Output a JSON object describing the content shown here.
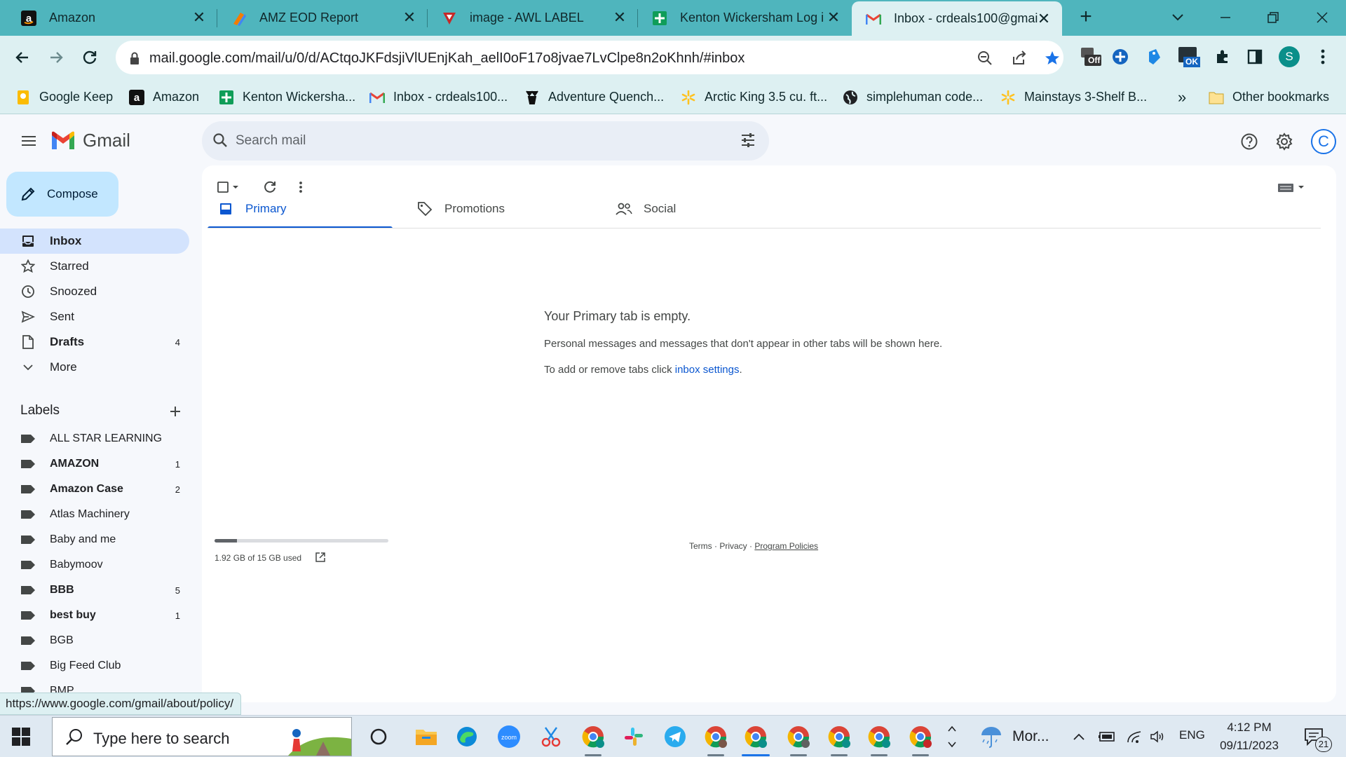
{
  "browser": {
    "tabs": [
      {
        "title": "Amazon",
        "icon": "amazon-icon",
        "active": false
      },
      {
        "title": "AMZ EOD Report",
        "icon": "report-icon",
        "active": false
      },
      {
        "title": "image - AWL LABEL",
        "icon": "awl-icon",
        "active": false
      },
      {
        "title": "Kenton Wickersham Log i",
        "icon": "sheets-icon",
        "active": false
      },
      {
        "title": "Inbox - crdeals100@gmai",
        "icon": "gmail-icon",
        "active": true
      }
    ],
    "url": "mail.google.com/mail/u/0/d/ACtqoJKFdsjiVlUEnjKah_aelI0oF17o8jvae7LvClpe8n2oKhnh/#inbox",
    "profile_initial": "S",
    "extension_badges": {
      "off": "Off",
      "ok": "OK"
    },
    "bookmarks": [
      {
        "label": "Google Keep",
        "icon": "keep-icon"
      },
      {
        "label": "Amazon",
        "icon": "amazon-icon"
      },
      {
        "label": "Kenton Wickersha...",
        "icon": "sheets-icon"
      },
      {
        "label": "Inbox - crdeals100...",
        "icon": "gmail-icon"
      },
      {
        "label": "Adventure Quench...",
        "icon": "deer-icon"
      },
      {
        "label": "Arctic King 3.5 cu. ft...",
        "icon": "walmart-icon"
      },
      {
        "label": "simplehuman code...",
        "icon": "globe-icon"
      },
      {
        "label": "Mainstays 3-Shelf B...",
        "icon": "walmart-icon"
      }
    ],
    "bookmarks_overflow": "»",
    "other_bookmarks": "Other bookmarks",
    "status_url": "https://www.google.com/gmail/about/policy/"
  },
  "gmail": {
    "app_name": "Gmail",
    "search_placeholder": "Search mail",
    "account_initial": "C",
    "compose_label": "Compose",
    "nav": [
      {
        "label": "Inbox",
        "count": "",
        "icon": "inbox-icon",
        "selected": true,
        "bold": true
      },
      {
        "label": "Starred",
        "count": "",
        "icon": "star-icon",
        "selected": false,
        "bold": false
      },
      {
        "label": "Snoozed",
        "count": "",
        "icon": "clock-icon",
        "selected": false,
        "bold": false
      },
      {
        "label": "Sent",
        "count": "",
        "icon": "send-icon",
        "selected": false,
        "bold": false
      },
      {
        "label": "Drafts",
        "count": "4",
        "icon": "draft-icon",
        "selected": false,
        "bold": true
      },
      {
        "label": "More",
        "count": "",
        "icon": "chevron-down-icon",
        "selected": false,
        "bold": false
      }
    ],
    "labels_title": "Labels",
    "labels": [
      {
        "label": "ALL STAR LEARNING",
        "count": "",
        "bold": false
      },
      {
        "label": "AMAZON",
        "count": "1",
        "bold": true
      },
      {
        "label": "Amazon Case",
        "count": "2",
        "bold": true
      },
      {
        "label": "Atlas Machinery",
        "count": "",
        "bold": false
      },
      {
        "label": "Baby and me",
        "count": "",
        "bold": false
      },
      {
        "label": "Babymoov",
        "count": "",
        "bold": false
      },
      {
        "label": "BBB",
        "count": "5",
        "bold": true
      },
      {
        "label": "best buy",
        "count": "1",
        "bold": true
      },
      {
        "label": "BGB",
        "count": "",
        "bold": false
      },
      {
        "label": "Big Feed Club",
        "count": "",
        "bold": false
      },
      {
        "label": "BMP",
        "count": "",
        "bold": false
      }
    ],
    "tabs": [
      {
        "label": "Primary",
        "icon": "inbox-tab-icon",
        "active": true
      },
      {
        "label": "Promotions",
        "icon": "tag-icon",
        "active": false
      },
      {
        "label": "Social",
        "icon": "people-icon",
        "active": false
      }
    ],
    "empty": {
      "title": "Your Primary tab is empty.",
      "line1": "Personal messages and messages that don't appear in other tabs will be shown here.",
      "line2_prefix": "To add or remove tabs click ",
      "line2_link": "inbox settings",
      "line2_suffix": "."
    },
    "storage": {
      "text": "1.92 GB of 15 GB used",
      "fraction": 0.128
    },
    "footer": {
      "terms": "Terms",
      "sep": " · ",
      "privacy": "Privacy",
      "policies": "Program Policies"
    }
  },
  "taskbar": {
    "search_text": "Type here to search",
    "weather_text": "Mor...",
    "language": "ENG",
    "time": "4:12 PM",
    "date": "09/11/2023",
    "notification_count": "21"
  }
}
